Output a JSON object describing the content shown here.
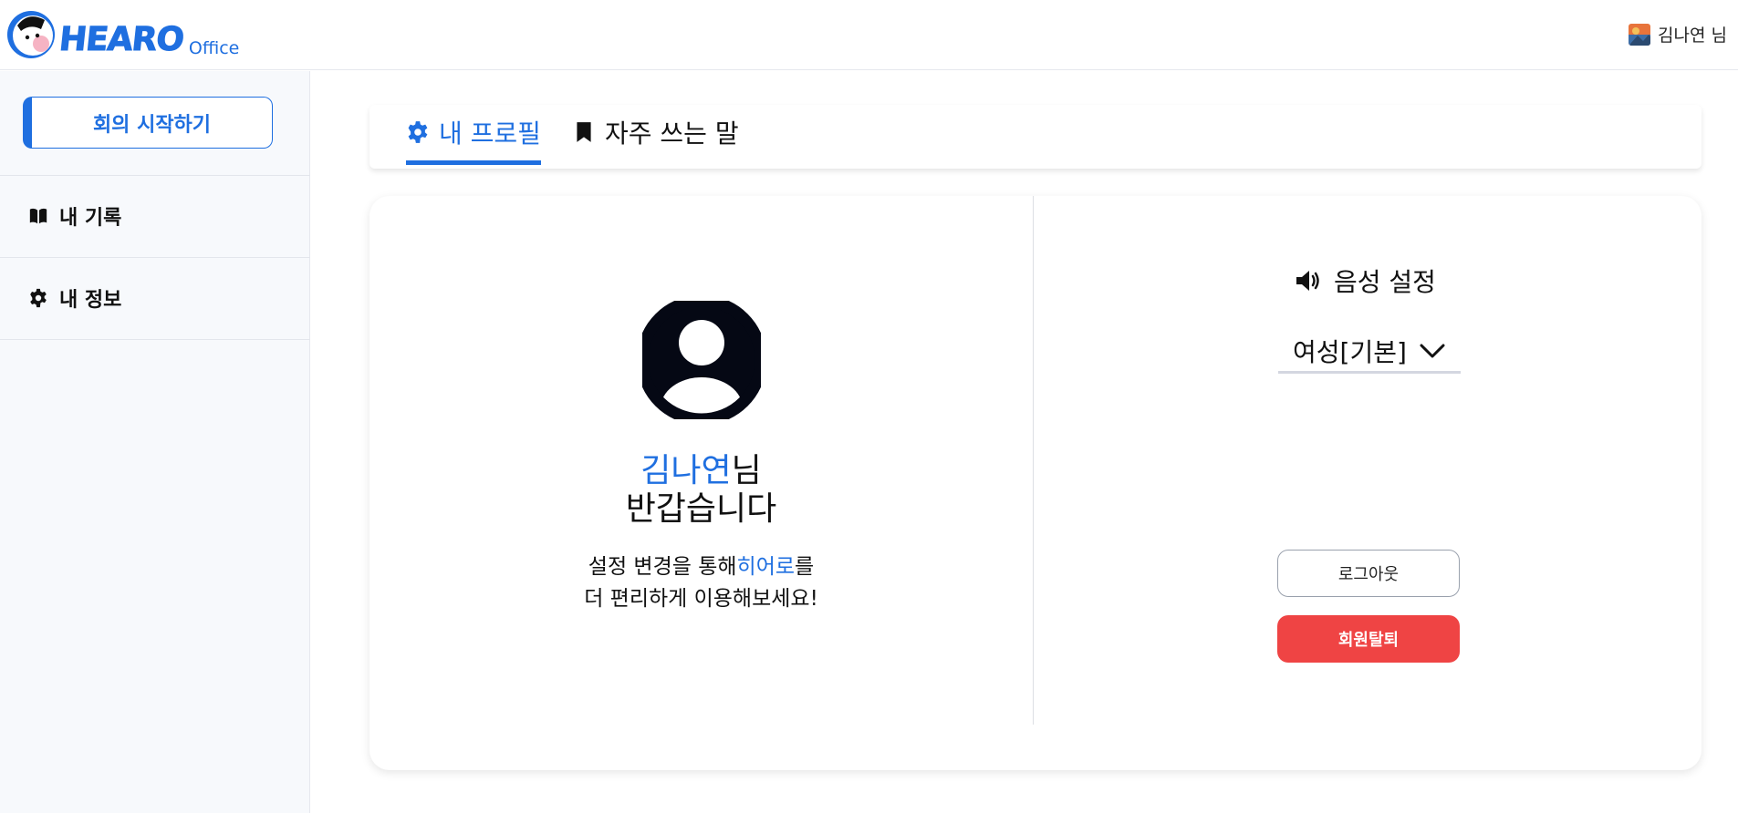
{
  "header": {
    "logo_word": "HEARO",
    "logo_sub": "Office",
    "user_name": "김나연 님"
  },
  "sidebar": {
    "start_meeting": "회의 시작하기",
    "items": [
      {
        "label": "내 기록",
        "icon": "book-icon"
      },
      {
        "label": "내 정보",
        "icon": "gear-icon"
      }
    ]
  },
  "tabs": [
    {
      "label": "내 프로필",
      "icon": "gear-icon",
      "active": true
    },
    {
      "label": "자주 쓰는 말",
      "icon": "bookmark-icon",
      "active": false
    }
  ],
  "profile": {
    "name": "김나연",
    "name_suffix": "님",
    "greeting": "반갑습니다",
    "desc_prefix": "설정 변경을 통해",
    "desc_highlight": "히어로",
    "desc_suffix": "를",
    "desc_line2": "더 편리하게 이용해보세요!"
  },
  "voice": {
    "title": "음성 설정",
    "selected": "여성[기본]"
  },
  "actions": {
    "logout": "로그아웃",
    "withdraw": "회원탈퇴"
  },
  "colors": {
    "accent": "#1f6fe0",
    "danger": "#ef4444"
  }
}
